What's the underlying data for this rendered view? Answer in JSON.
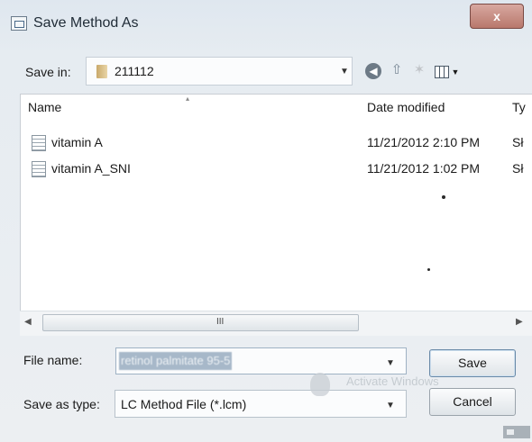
{
  "window": {
    "title": "Save Method As",
    "close_label": "x"
  },
  "save_in": {
    "label": "Save in:",
    "value": "211112"
  },
  "toolbar": {
    "icons": [
      "back-icon",
      "up-folder-icon",
      "new-folder-icon",
      "view-menu-icon"
    ]
  },
  "file_list": {
    "columns": [
      "Name",
      "Date modified",
      "Ty"
    ],
    "rows": [
      {
        "name": "vitamin A",
        "date": "11/21/2012 2:10 PM",
        "type": "Sł"
      },
      {
        "name": "vitamin A_SNI",
        "date": "11/21/2012 1:02 PM",
        "type": "Sł"
      }
    ],
    "scrollbar_grip": "III"
  },
  "file_name": {
    "label": "File name:",
    "value": "retinol palmitate 95-5"
  },
  "save_as_type": {
    "label": "Save as type:",
    "value": "LC Method File (*.lcm)"
  },
  "buttons": {
    "save": "Save",
    "cancel": "Cancel"
  },
  "watermark": {
    "line1": "Activate Windows"
  }
}
